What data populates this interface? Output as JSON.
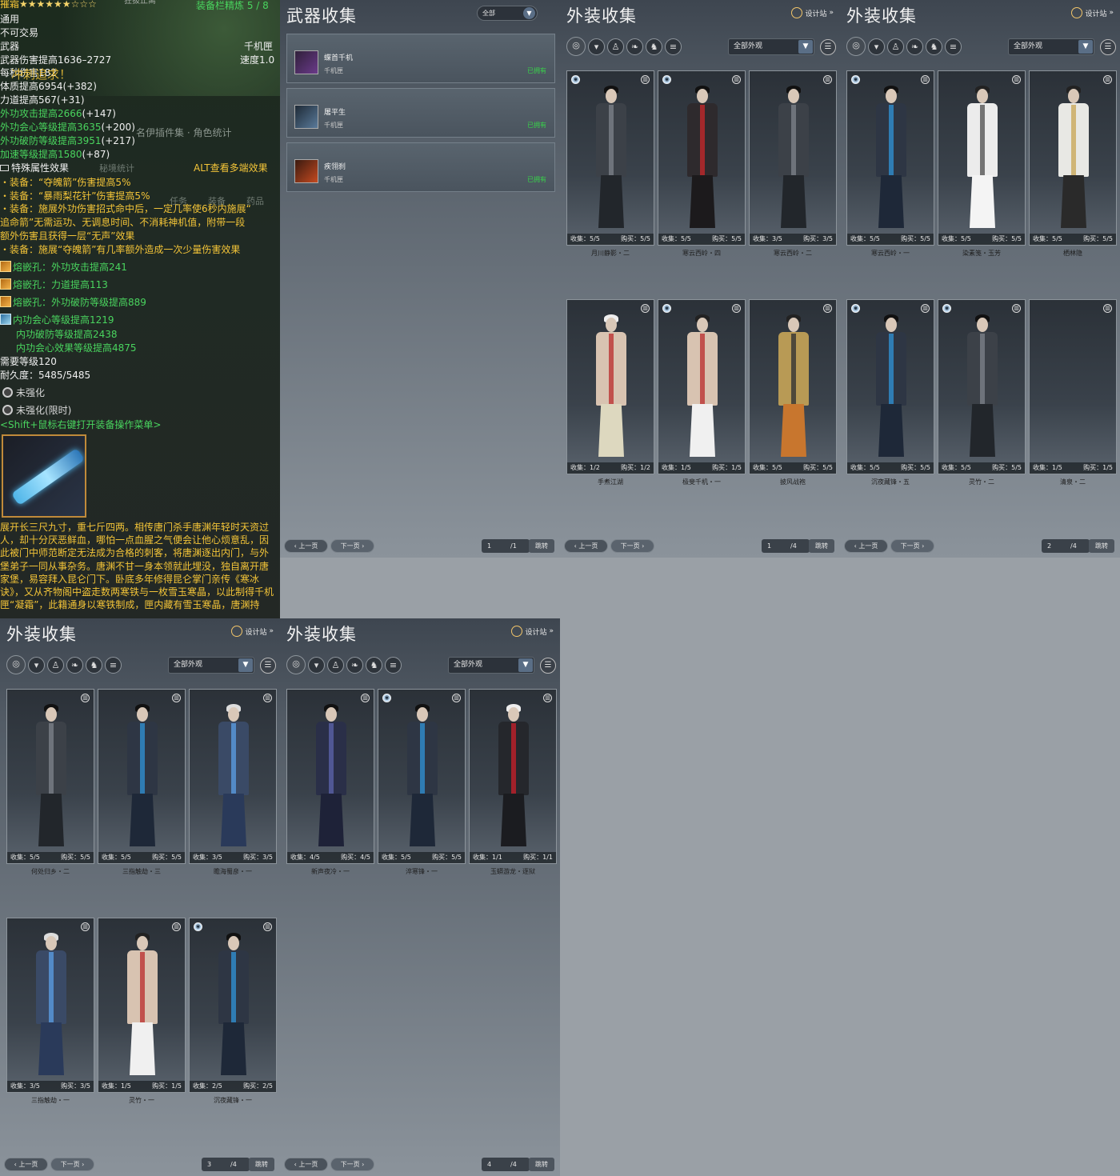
{
  "tooltip": {
    "item_name": "摧霜",
    "stars": "★★★★★★☆☆☆",
    "top_note": "狂拔止离",
    "refine": "装备栏精炼 5 / 8",
    "type": "通用",
    "trade": "不可交易",
    "slot": "武器",
    "school": "千机匣",
    "damage": "武器伤害提高1636–2727",
    "speed": "速度1.0",
    "dps_line": "每秒伤害182",
    "overlay_text": "冲刺追求！",
    "stats_white": [
      {
        "text": "体质提高6954",
        "bonus": "(+382)"
      },
      {
        "text": "力道提高567",
        "bonus": "(+31)"
      }
    ],
    "stats_green": [
      {
        "text": "外功攻击提高2666",
        "bonus": "(+147)"
      },
      {
        "text": "外功会心等级提高3635",
        "bonus": "(+200)"
      },
      {
        "text": "外功破防等级提高3951",
        "bonus": "(+217)"
      },
      {
        "text": "加速等级提高1580",
        "bonus": "(+87)"
      }
    ],
    "special_title": "特殊属性效果",
    "alt_hint": "ALT查看多端效果",
    "effects": [
      "・装备：“夺魄箭”伤害提高5%",
      "・装备：“暴雨梨花针”伤害提高5%",
      "・装备：施展外功伤害招式命中后，一定几率使6秒内施展“",
      "追命箭”无需运功、无调息时间、不消耗神机值，附带一段",
      "额外伤害且获得一层“无声”效果",
      "・装备：施展“夺魄箭”有几率额外造成一次少量伤害效果"
    ],
    "gems": [
      "熔嵌孔：外功攻击提高241",
      "熔嵌孔：力道提高113",
      "熔嵌孔：外功破防等级提高889"
    ],
    "enchant": [
      "内功会心等级提高1219",
      "内功破防等级提高2438",
      "内功会心效果等级提高4875"
    ],
    "require_level": "需要等级120",
    "durability": "耐久度：5485/5485",
    "unstrength_1": "未强化",
    "unstrength_2": "未强化(限时)",
    "shift_hint": "<Shift+鼠标右键打开装备操作菜单>",
    "description": "展开长三尺九寸，重七斤四两。相传唐门杀手唐渊年轻时天资过人，却十分厌恶鲜血，哪怕一点血腥之气便会让他心烦意乱，因此被门中师范断定无法成为合格的刺客，将唐渊逐出内门，与外堡弟子一同从事杂务。唐渊不甘一身本领就此埋没，独自离开唐家堡，易容拜入昆仑门下。卧底多年修得昆仑掌门亲传《寒冰诀》，又从齐物阁中盗走数两寒铁与一枚雪玉寒晶，以此制得千机匣“凝霜”，此籍通身以寒铁制成，匣内藏有雪玉寒晶，唐渊持",
    "faded_bg": [
      "名伊插件集 · 角色统计",
      "秘境统计",
      "任务",
      "装备",
      "药品"
    ]
  },
  "weapon_panel": {
    "title": "武器收集",
    "filter": "全部",
    "items": [
      {
        "name": "蝶首千机",
        "type": "千机匣",
        "status": "已拥有"
      },
      {
        "name": "屠平生",
        "type": "千机匣",
        "status": "已拥有"
      },
      {
        "name": "疾翎刹",
        "type": "千机匣",
        "status": "已拥有"
      }
    ],
    "page": "1",
    "total": "/1",
    "prev": "上一页",
    "next": "下一页",
    "jump": "跳转"
  },
  "outfit_common": {
    "title": "外装收集",
    "designer": "设计站",
    "filter": "全部外观",
    "collect_label": "收集：",
    "buy_label": "购买：",
    "prev": "上一页",
    "next": "下一页",
    "jump": "跳转",
    "total": "/4"
  },
  "outfit_panels": [
    {
      "page": "1",
      "cards": [
        {
          "name": "月川静影・二",
          "collect": "5/5",
          "buy": "5/5",
          "badge": true,
          "theme": "dark"
        },
        {
          "name": "寒云西岭・四",
          "collect": "5/5",
          "buy": "5/5",
          "badge": true,
          "theme": "red"
        },
        {
          "name": "寒云西岭・二",
          "collect": "3/5",
          "buy": "3/5",
          "badge": false,
          "theme": "dark"
        },
        {
          "name": "手煮江湖",
          "collect": "1/2",
          "buy": "1/2",
          "badge": false,
          "theme": "bare"
        },
        {
          "name": "极斐千机・一",
          "collect": "1/5",
          "buy": "1/5",
          "badge": true,
          "theme": "bare2"
        },
        {
          "name": "披风战袍",
          "collect": "5/5",
          "buy": "5/5",
          "badge": false,
          "theme": "gold"
        }
      ]
    },
    {
      "page": "2",
      "cards": [
        {
          "name": "寒云西岭・一",
          "collect": "5/5",
          "buy": "5/5",
          "badge": true,
          "theme": "blue"
        },
        {
          "name": "染素笺・玉芳",
          "collect": "5/5",
          "buy": "5/5",
          "badge": false,
          "theme": "white"
        },
        {
          "name": "栖林隐",
          "collect": "5/5",
          "buy": "5/5",
          "badge": false,
          "theme": "white2"
        },
        {
          "name": "沉夜藏锋・五",
          "collect": "5/5",
          "buy": "5/5",
          "badge": true,
          "theme": "blue"
        },
        {
          "name": "灵竹・二",
          "collect": "5/5",
          "buy": "5/5",
          "badge": true,
          "theme": "dark"
        },
        {
          "name": "清泉・二",
          "collect": "1/5",
          "buy": "1/5",
          "badge": false,
          "theme": "empty"
        }
      ]
    },
    {
      "page": "3",
      "cards": [
        {
          "name": "何处归乡・二",
          "collect": "5/5",
          "buy": "5/5",
          "badge": false,
          "theme": "dark"
        },
        {
          "name": "三指触劫・三",
          "collect": "5/5",
          "buy": "5/5",
          "badge": false,
          "theme": "blue"
        },
        {
          "name": "瞻海蜀彦・一",
          "collect": "3/5",
          "buy": "3/5",
          "badge": false,
          "theme": "blue2"
        },
        {
          "name": "三指触劫・一",
          "collect": "3/5",
          "buy": "3/5",
          "badge": false,
          "theme": "blue2"
        },
        {
          "name": "灵竹・一",
          "collect": "1/5",
          "buy": "1/5",
          "badge": false,
          "theme": "bare2"
        },
        {
          "name": "沉夜藏锋・一",
          "collect": "2/5",
          "buy": "2/5",
          "badge": true,
          "theme": "blue"
        }
      ]
    },
    {
      "page": "4",
      "cards": [
        {
          "name": "新声夜冷・一",
          "collect": "4/5",
          "buy": "4/5",
          "badge": false,
          "theme": "navy"
        },
        {
          "name": "淬寒锋・一",
          "collect": "5/5",
          "buy": "5/5",
          "badge": true,
          "theme": "blue"
        },
        {
          "name": "玉蟒游龙・逐狱",
          "collect": "1/1",
          "buy": "1/1",
          "badge": false,
          "theme": "red2"
        }
      ]
    }
  ]
}
